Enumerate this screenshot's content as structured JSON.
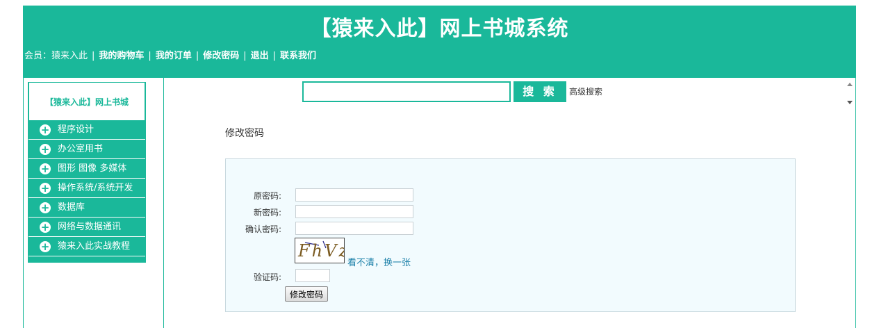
{
  "header": {
    "title": "【猿来入此】网上书城系统",
    "member_label": "会员：猿来入此",
    "nav": [
      "我的购物车",
      "我的订单",
      "修改密码",
      "退出",
      "联系我们"
    ],
    "separator": "|"
  },
  "sidebar": {
    "title": "【猿来入此】网上书城",
    "items": [
      {
        "label": "程序设计",
        "icon": "plus-circle-icon"
      },
      {
        "label": "办公室用书",
        "icon": "plus-circle-icon"
      },
      {
        "label": "图形 图像 多媒体",
        "icon": "plus-circle-icon"
      },
      {
        "label": "操作系统/系统开发",
        "icon": "plus-circle-icon"
      },
      {
        "label": "数据库",
        "icon": "plus-circle-icon"
      },
      {
        "label": "网络与数据通讯",
        "icon": "plus-circle-icon"
      },
      {
        "label": "猿来入此实战教程",
        "icon": "plus-circle-icon"
      }
    ]
  },
  "search": {
    "value": "",
    "button_label": "搜 索",
    "advanced_label": "高级搜索"
  },
  "page": {
    "heading": "修改密码"
  },
  "form": {
    "old_password_label": "原密码:",
    "new_password_label": "新密码:",
    "confirm_password_label": "确认密码:",
    "captcha_text": "FhVz",
    "refresh_captcha_label": "看不清，换一张",
    "captcha_label": "验证码:",
    "submit_label": "修改密码"
  },
  "colors": {
    "accent": "#1ab89a",
    "form_background": "#f2fbfe",
    "link": "#1a7fa8"
  }
}
